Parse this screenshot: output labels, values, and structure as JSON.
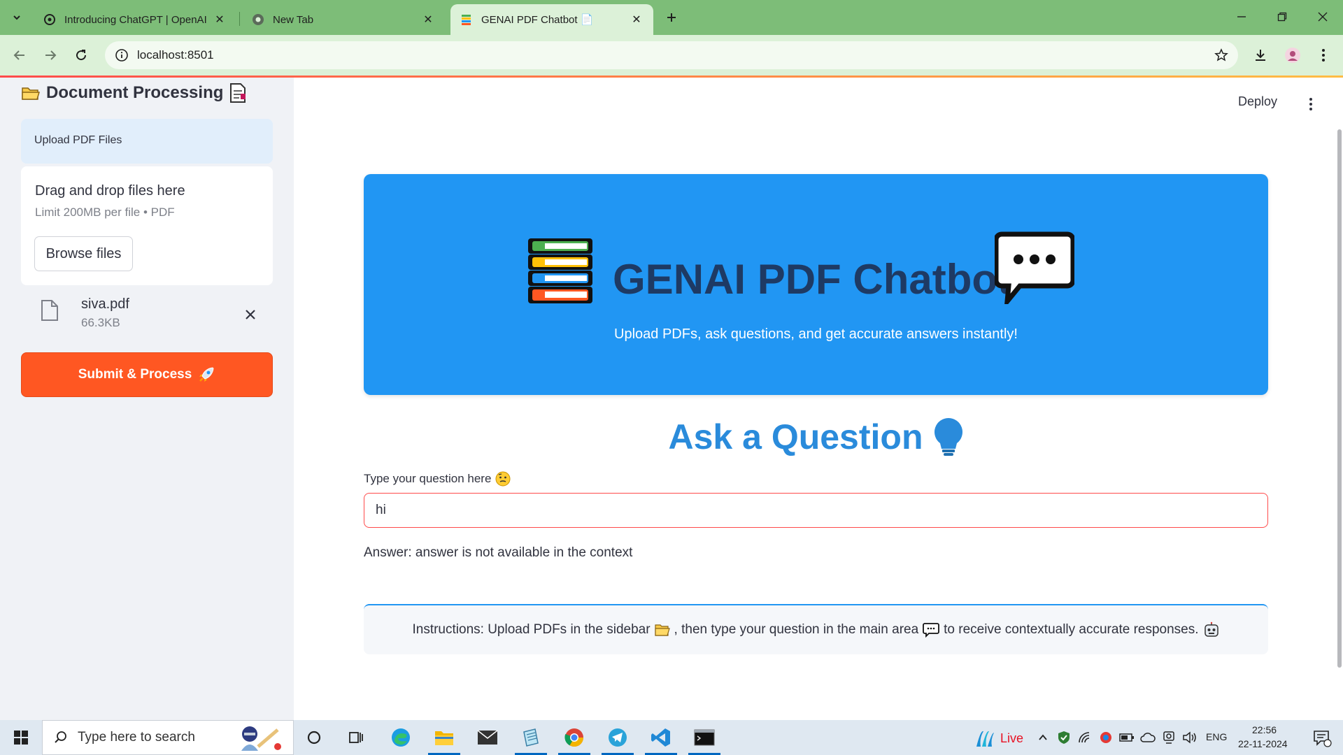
{
  "browser": {
    "tabs": [
      {
        "title": "Introducing ChatGPT | OpenAI",
        "active": false
      },
      {
        "title": "New Tab",
        "active": false
      },
      {
        "title": "GENAI PDF Chatbot 📄",
        "active": true
      }
    ],
    "url": "localhost:8501"
  },
  "sidebar": {
    "title": "Document Processing",
    "upload_label": "Upload PDF Files",
    "dropzone_title": "Drag and drop files here",
    "dropzone_limit": "Limit 200MB per file • PDF",
    "browse_label": "Browse files",
    "file": {
      "name": "siva.pdf",
      "size": "66.3KB"
    },
    "submit_label": "Submit & Process"
  },
  "header": {
    "deploy_label": "Deploy"
  },
  "hero": {
    "title": "GENAI PDF Chatbot",
    "subtitle": "Upload PDFs, ask questions, and get accurate answers instantly!",
    "color": "#2196f3"
  },
  "ask": {
    "title": "Ask a Question",
    "input_label": "Type your question here",
    "input_value": "hi"
  },
  "answer": "Answer: answer is not available in the context",
  "instructions": {
    "part1": "Instructions: Upload PDFs in the sidebar",
    "part2": ", then type your question in the main area",
    "part3": "to receive contextually accurate responses."
  },
  "taskbar": {
    "search_placeholder": "Type here to search",
    "live_label": "Live",
    "language": "ENG",
    "time": "22:56",
    "date": "22-11-2024"
  },
  "colors": {
    "accent": "#ff4b4b",
    "submit": "#ff5722",
    "tabstrip": "#7dbd78",
    "toolbar": "#dcf1d8"
  }
}
